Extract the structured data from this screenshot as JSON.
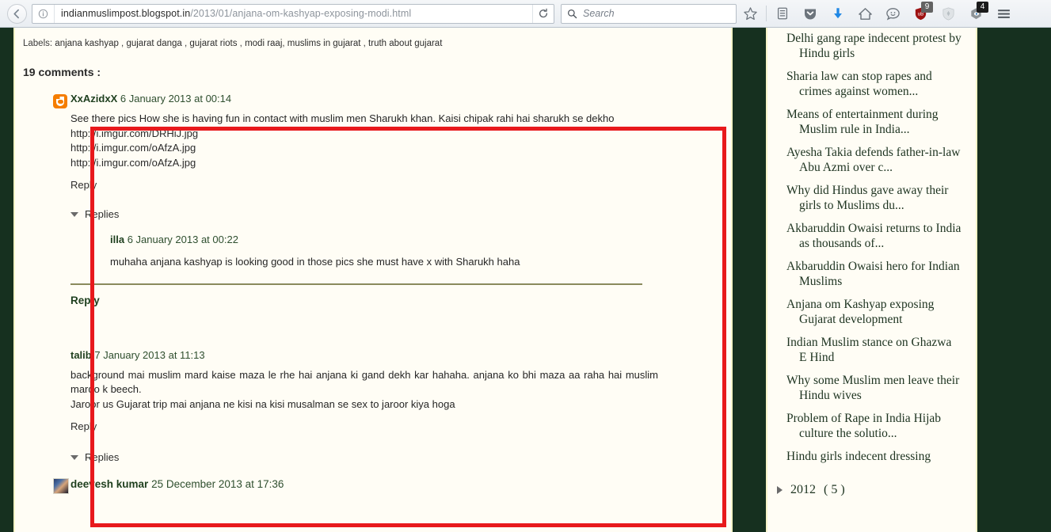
{
  "browser": {
    "back_label": "back",
    "url_host": "indianmuslimpost.blogspot.in",
    "url_path": "/2013/01/anjana-om-kashyap-exposing-modi.html",
    "reload_label": "reload",
    "search_placeholder": "Search",
    "toolbar_icons": [
      {
        "name": "bookmark-star-icon",
        "badge": ""
      },
      {
        "name": "reading-list-icon",
        "badge": ""
      },
      {
        "name": "pocket-icon",
        "badge": ""
      },
      {
        "name": "downloads-icon",
        "badge": ""
      },
      {
        "name": "home-icon",
        "badge": ""
      },
      {
        "name": "chat-bubble-icon",
        "badge": ""
      },
      {
        "name": "ublock-origin-icon",
        "badge": "9"
      },
      {
        "name": "shield-icon",
        "badge": ""
      },
      {
        "name": "privacy-badger-icon",
        "badge": "4"
      },
      {
        "name": "hamburger-menu-icon",
        "badge": ""
      }
    ]
  },
  "post": {
    "labels_prefix": "Labels:",
    "labels": [
      "anjana kashyap",
      "gujarat danga",
      "gujarat riots",
      "modi raaj",
      "muslims in gujarat",
      "truth about gujarat"
    ],
    "comments_heading": "19 comments :"
  },
  "comments": [
    {
      "avatar": "blogger-icon",
      "author": "XxAzidxX",
      "date": "6 January 2013 at 00:14",
      "body_lines": [
        "See there pics How she is having fun in contact with muslim men Sharukh khan. Kaisi chipak rahi hai sharukh se dekho",
        "http://i.imgur.com/DRHiJ.jpg",
        "http://i.imgur.com/oAfzA.jpg",
        "http://i.imgur.com/oAfzA.jpg"
      ],
      "reply_label": "Reply",
      "replies_toggle": "Replies",
      "replies": [
        {
          "author": "illa",
          "date": "6 January 2013 at 00:22",
          "body": "muhaha anjana kashyap is looking good in those pics she must have x with Sharukh haha"
        }
      ],
      "reply_link_label": "Reply"
    },
    {
      "avatar": "none",
      "author": "talib",
      "date": "7 January 2013 at 11:13",
      "body_lines": [
        "background mai muslim mard kaise maza le rhe hai anjana ki gand dekh kar hahaha. anjana ko bhi maza aa raha hai muslim mardo k beech.",
        "Jaroor us Gujarat trip mai anjana ne kisi na kisi musalman se sex to jaroor kiya hoga"
      ],
      "reply_label": "Reply",
      "replies_toggle": "Replies",
      "replies": [],
      "reply_link_label": ""
    },
    {
      "avatar": "photo-avatar",
      "author": "deevesh kumar",
      "date": "25 December 2013 at 17:36",
      "body_lines": [],
      "reply_label": "",
      "replies_toggle": "",
      "replies": [],
      "reply_link_label": ""
    }
  ],
  "sidebar": {
    "posts": [
      "Delhi gang rape indecent protest by Hindu girls",
      "Sharia law can stop rapes and crimes against women...",
      "Means of entertainment during Muslim rule in India...",
      "Ayesha Takia defends father-in-law Abu Azmi over c...",
      "Why did Hindus gave away their girls to Muslims du...",
      "Akbaruddin Owaisi returns to India as thousands of...",
      "Akbaruddin Owaisi hero for Indian Muslims",
      "Anjana om Kashyap exposing Gujarat development",
      "Indian Muslim stance on Ghazwa E Hind",
      "Why some Muslim men leave their Hindu wives",
      "Problem of Rape in India Hijab culture the solutio...",
      "Hindu girls indecent dressing"
    ],
    "archive": {
      "year": "2012",
      "count": "( 5 )"
    }
  },
  "annotation": {
    "color": "#e8191c",
    "label": "red-highlight-box"
  },
  "colors": {
    "page_background": "#16301f",
    "content_background": "#fffdf5",
    "content_border": "#f7f4c8",
    "link_green": "#1e3f1e",
    "annotation_red": "#e8191c"
  }
}
